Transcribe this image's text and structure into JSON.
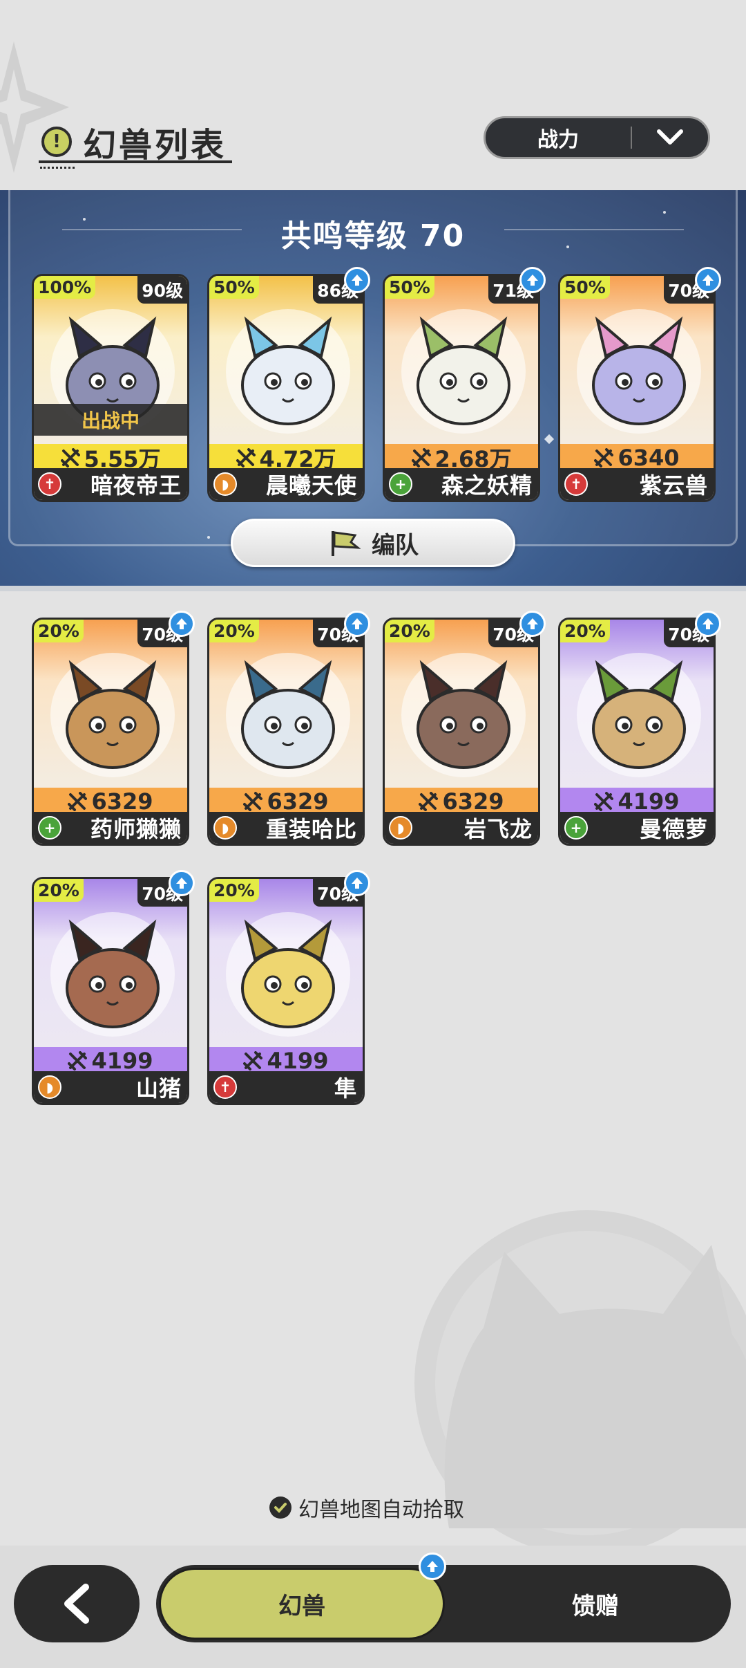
{
  "header": {
    "title": "幻兽列表",
    "sort_label": "战力"
  },
  "team": {
    "resonance_label": "共鸣等级 70",
    "formation_label": "编队",
    "active_label": "出战中",
    "members": [
      {
        "pct": "100%",
        "level": "90级",
        "power": "5.55万",
        "name": "暗夜帝王",
        "role": "attack",
        "theme": "yellow",
        "upgradable": false,
        "active": true
      },
      {
        "pct": "50%",
        "level": "86级",
        "power": "4.72万",
        "name": "晨曦天使",
        "role": "defend",
        "theme": "yellow",
        "upgradable": true,
        "active": false
      },
      {
        "pct": "50%",
        "level": "71级",
        "power": "2.68万",
        "name": "森之妖精",
        "role": "heal",
        "theme": "orange",
        "upgradable": true,
        "active": false
      },
      {
        "pct": "50%",
        "level": "70级",
        "power": "6340",
        "name": "紫云兽",
        "role": "attack",
        "theme": "orange",
        "upgradable": true,
        "active": false
      }
    ]
  },
  "roster": [
    {
      "pct": "20%",
      "level": "70级",
      "power": "6329",
      "name": "药师獭獭",
      "role": "heal",
      "theme": "orange",
      "upgradable": true
    },
    {
      "pct": "20%",
      "level": "70级",
      "power": "6329",
      "name": "重装哈比",
      "role": "defend",
      "theme": "orange",
      "upgradable": true
    },
    {
      "pct": "20%",
      "level": "70级",
      "power": "6329",
      "name": "岩飞龙",
      "role": "defend",
      "theme": "orange",
      "upgradable": true
    },
    {
      "pct": "20%",
      "level": "70级",
      "power": "4199",
      "name": "曼德萝",
      "role": "heal",
      "theme": "purple",
      "upgradable": true
    },
    {
      "pct": "20%",
      "level": "70级",
      "power": "4199",
      "name": "山猪",
      "role": "defend",
      "theme": "purple",
      "upgradable": true
    },
    {
      "pct": "20%",
      "level": "70级",
      "power": "4199",
      "name": "隼",
      "role": "attack",
      "theme": "purple",
      "upgradable": true
    }
  ],
  "footer": {
    "auto_pickup_label": "幻兽地图自动拾取",
    "tab_beasts": "幻兽",
    "tab_gift": "馈赠"
  },
  "colors": {
    "accent": "#c9cc6c",
    "upgrade_badge": "#2f8fe0",
    "attack": "#d63a3a",
    "defend": "#e58a2a",
    "heal": "#4aa33a"
  },
  "icons": [
    "alert-icon",
    "chevron-down-icon",
    "flag-icon",
    "upgrade-arrow-icon",
    "sword-power-icon",
    "attack-role-icon",
    "defend-role-icon",
    "heal-role-icon",
    "check-icon",
    "back-arrow-icon"
  ]
}
